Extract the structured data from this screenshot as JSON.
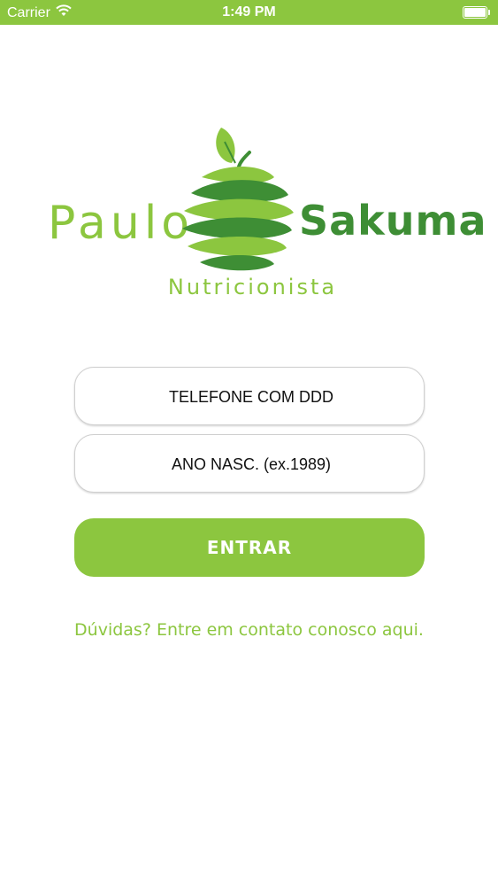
{
  "status_bar": {
    "carrier": "Carrier",
    "time": "1:49 PM",
    "wifi_icon": "wifi-icon",
    "battery_icon": "battery-icon"
  },
  "logo": {
    "left_word": "Paulo",
    "right_word": "Sakuma",
    "subtitle": "Nutricionista",
    "icon": "apple-spiral-icon"
  },
  "form": {
    "phone_placeholder": "TELEFONE COM DDD",
    "phone_value": "",
    "year_placeholder": "ANO NASC. (ex.1989)",
    "year_value": "",
    "submit_label": "ENTRAR"
  },
  "help": {
    "text": "Dúvidas? Entre em contato conosco aqui."
  },
  "colors": {
    "brand_light_green": "#8cc63f",
    "brand_dark_green": "#3e8e35",
    "background": "#ffffff"
  }
}
